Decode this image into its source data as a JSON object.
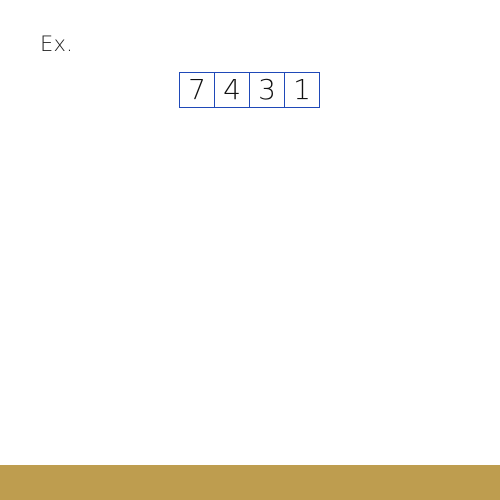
{
  "label": "Ex.",
  "digits": [
    "7",
    "4",
    "3",
    "1"
  ],
  "colors": {
    "box_border": "#1f49b8",
    "footer": "#be9d4f"
  }
}
